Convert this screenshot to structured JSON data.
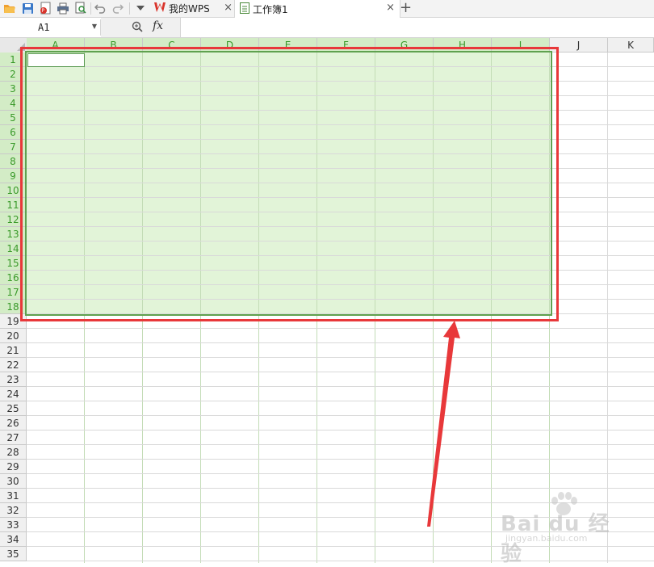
{
  "toolbar": {
    "icons": [
      "open-folder-icon",
      "save-icon",
      "pdf-export-icon",
      "print-icon",
      "print-preview-icon",
      "undo-icon",
      "redo-icon",
      "dropdown-arrow-icon"
    ]
  },
  "tabs": [
    {
      "label": "我的WPS",
      "icon": "wps-logo-icon",
      "active": false
    },
    {
      "label": "工作簿1",
      "icon": "spreadsheet-doc-icon",
      "active": true
    }
  ],
  "tab_close": "×",
  "add_tab": "+",
  "formula_bar": {
    "name_box": "A1",
    "fx_label": "fx",
    "formula_value": ""
  },
  "columns": [
    "A",
    "B",
    "C",
    "D",
    "E",
    "F",
    "G",
    "H",
    "I",
    "J",
    "K"
  ],
  "rows": [
    "1",
    "2",
    "3",
    "4",
    "5",
    "6",
    "7",
    "8",
    "9",
    "10",
    "11",
    "12",
    "13",
    "14",
    "15",
    "16",
    "17",
    "18",
    "19",
    "20",
    "21",
    "22",
    "23",
    "24",
    "25",
    "26",
    "27",
    "28",
    "29",
    "30",
    "31",
    "32",
    "33",
    "34",
    "35"
  ],
  "selection": {
    "range": "A1:I18",
    "active_cell": "A1"
  },
  "colors": {
    "selection_fill": "#e2f4d8",
    "selected_header_text": "#3a9a2a",
    "selection_border": "#5fa14f",
    "annotation_red": "#e8383a"
  },
  "watermark": {
    "brand": "Bai du 经验",
    "url": "jingyan.baidu.com"
  }
}
